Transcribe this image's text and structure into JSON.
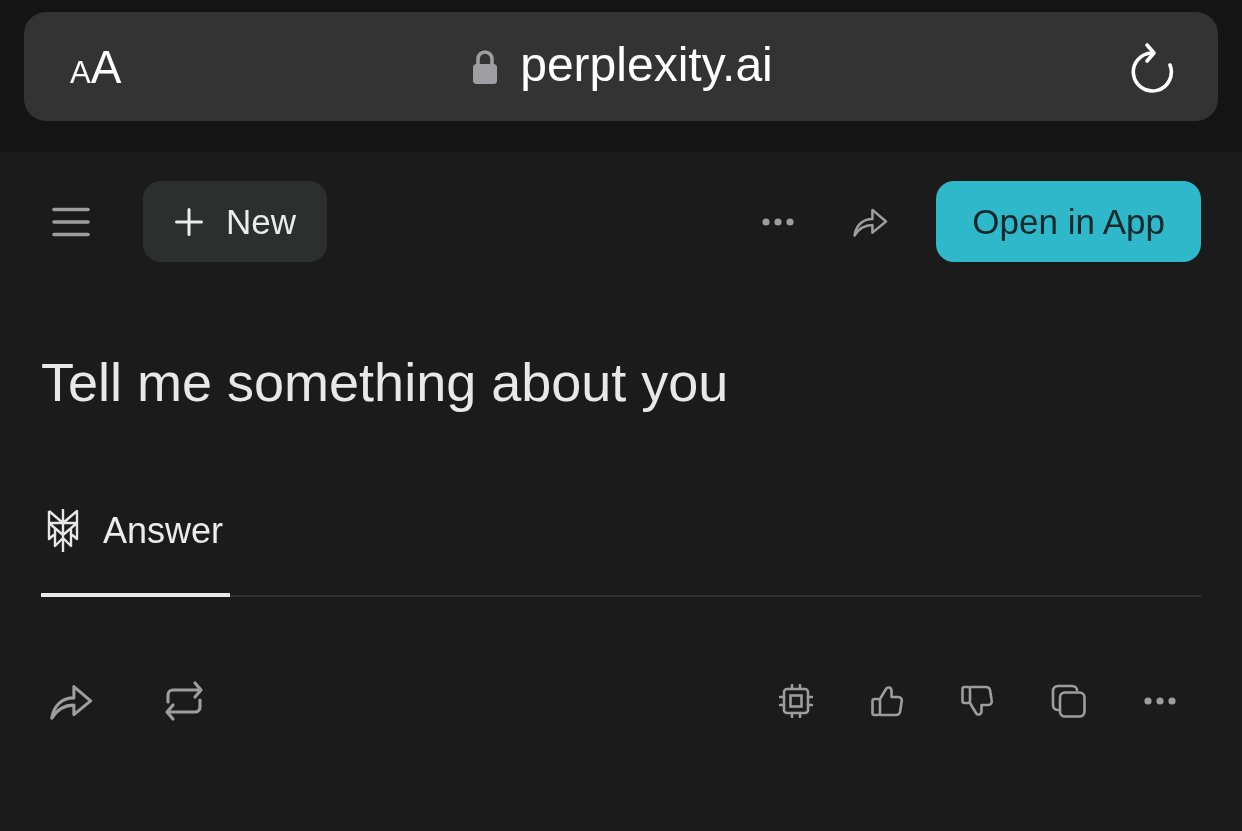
{
  "browser_bar": {
    "text_size_button": "AA",
    "address": "perplexity.ai"
  },
  "header": {
    "new_button": "New",
    "open_app_button": "Open in App"
  },
  "thread": {
    "query": "Tell me something about you",
    "tabs": [
      {
        "label": "Answer",
        "selected": true
      }
    ]
  }
}
